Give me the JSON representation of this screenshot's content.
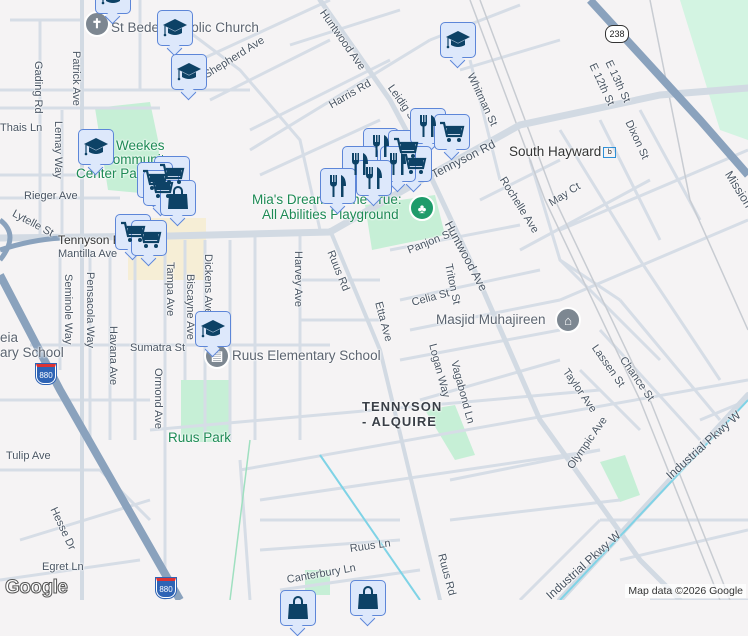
{
  "colors": {
    "background": "#f5f3f4",
    "park": "#c6efd6",
    "road": "#d6dde6",
    "freeway": "#8aa2bd",
    "marker_fill": "#dde8fb",
    "marker_border": "#5d86d8",
    "icon": "#0d4266"
  },
  "streets": {
    "patrick": "Patrick Ave",
    "gading": "Gading Rd",
    "lemay": "Lemay Way",
    "thais": "Thais Ln",
    "shepherd": "Shepherd Ave",
    "harris": "Harris Rd",
    "huntwood_top": "Huntwood Ave",
    "leidig": "Leidig St",
    "whitman": "Whitman St",
    "e13": "E 13th St",
    "e12": "E 12th St",
    "dixon": "Dixon St",
    "tennyson_e": "Tennyson Rd",
    "rochelle": "Rochelle Ave",
    "may": "May Ct",
    "mission": "Mission Blvd",
    "rieger": "Rieger Ave",
    "lytelle": "Lytelle St",
    "tennyson_w": "Tennyson Rd",
    "mantilla": "Mantilla Ave",
    "ruus_n": "Ruus Rd",
    "harvey": "Harvey Ave",
    "dickens": "Dickens Ave",
    "biscayne": "Biscayne Ave",
    "tampa": "Tampa Ave",
    "pensacola": "Pensacola Way",
    "seminole": "Seminole Way",
    "havana": "Havana Ave",
    "ormond": "Ormond Ave",
    "panjon": "Panjon St",
    "triton": "Triton St",
    "huntwood_s": "Huntwood Ave",
    "celia": "Celia St",
    "etta": "Etta Ave",
    "logan": "Logan Way",
    "vagabond": "Vagabond Ln",
    "lassen": "Lassen St",
    "chance": "Chance St",
    "taylor": "Taylor Ave",
    "olympic": "Olympic Ave",
    "industrial1": "Industrial Pkwy W",
    "industrial2": "Industrial Pkwy W",
    "sumatra": "Sumatra St",
    "tulip": "Tulip Ave",
    "hesse": "Hesse Dr",
    "egret": "Egret Ln",
    "ruus_ln": "Ruus Ln",
    "canterbury": "Canterbury Ln",
    "ruus_s": "Ruus Rd"
  },
  "places": {
    "church": "St Bede Catholic Church",
    "weekes_1": "Weekes",
    "weekes_2": "Community",
    "weekes_3": "Center Park",
    "mias_1": "Mia's Dream Come True:",
    "mias_2": "All Abilities Playground",
    "south_hayward": "South Hayward",
    "bart_icon": "b",
    "masjid": "Masjid Muhajireen",
    "ruus_school": "Ruus Elementary School",
    "left_school_1": "eia",
    "left_school_2": "ary School",
    "ruus_park": "Ruus Park",
    "hood_1": "TENNYSON",
    "hood_2": "- ALQUIRE"
  },
  "shields": {
    "i880_a": "880",
    "i880_b": "880",
    "ca238": "238"
  },
  "markers": [
    "school-icon",
    "school-icon",
    "school-icon",
    "school-icon",
    "school-icon",
    "shopping-cart-icon",
    "shopping-cart-icon",
    "shopping-bag-icon",
    "shopping-cart-icon",
    "shopping-cart-icon",
    "restaurant-icon",
    "restaurant-icon",
    "restaurant-icon",
    "shopping-cart-icon",
    "shopping-bag-icon"
  ],
  "footer": {
    "logo": "Google",
    "attribution": "Map data ©2026 Google"
  }
}
